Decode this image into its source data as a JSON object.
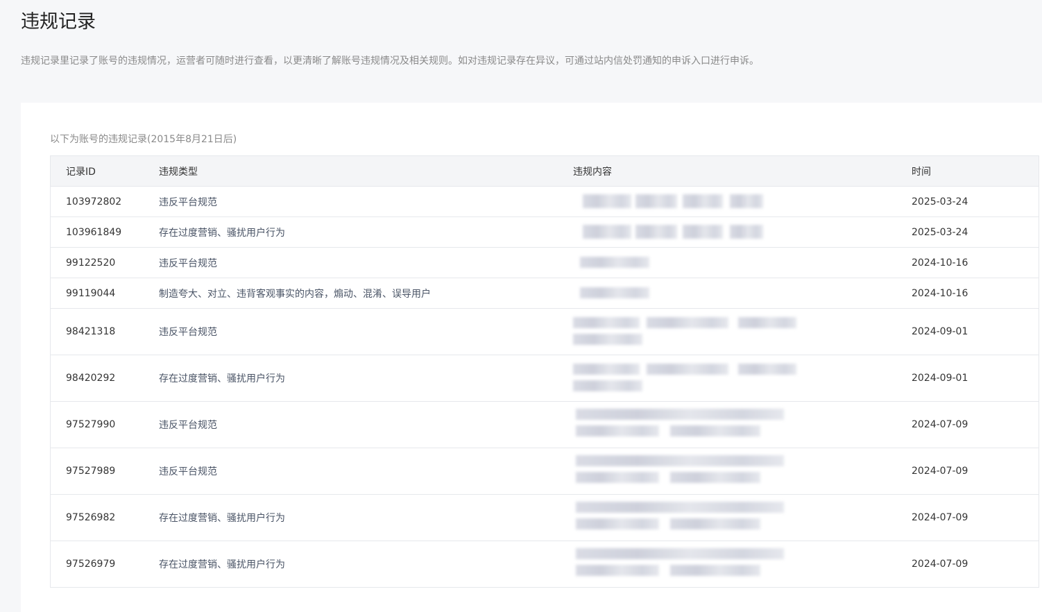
{
  "page": {
    "title": "违规记录",
    "description": "违规记录里记录了账号的违规情况，运营者可随时进行查看，以更清晰了解账号违规情况及相关规则。如对违规记录存在异议，可通过站内信处罚通知的申诉入口进行申诉。"
  },
  "table": {
    "caption": "以下为账号的违规记录(2015年8月21日后)",
    "headers": {
      "id": "记录ID",
      "type": "违规类型",
      "content": "违规内容",
      "time": "时间"
    },
    "rows": [
      {
        "id": "103972802",
        "type": "违反平台规范",
        "time": "2025-03-24",
        "lines": 1
      },
      {
        "id": "103961849",
        "type": "存在过度营销、骚扰用户行为",
        "time": "2025-03-24",
        "lines": 1
      },
      {
        "id": "99122520",
        "type": "违反平台规范",
        "time": "2024-10-16",
        "lines": 1
      },
      {
        "id": "99119044",
        "type": "制造夸大、对立、违背客观事实的内容，煽动、混淆、误导用户",
        "time": "2024-10-16",
        "lines": 1
      },
      {
        "id": "98421318",
        "type": "违反平台规范",
        "time": "2024-09-01",
        "lines": 2
      },
      {
        "id": "98420292",
        "type": "存在过度营销、骚扰用户行为",
        "time": "2024-09-01",
        "lines": 2
      },
      {
        "id": "97527990",
        "type": "违反平台规范",
        "time": "2024-07-09",
        "lines": 2
      },
      {
        "id": "97527989",
        "type": "违反平台规范",
        "time": "2024-07-09",
        "lines": 2
      },
      {
        "id": "97526982",
        "type": "存在过度营销、骚扰用户行为",
        "time": "2024-07-09",
        "lines": 2
      },
      {
        "id": "97526979",
        "type": "存在过度营销、骚扰用户行为",
        "time": "2024-07-09",
        "lines": 2
      }
    ]
  }
}
